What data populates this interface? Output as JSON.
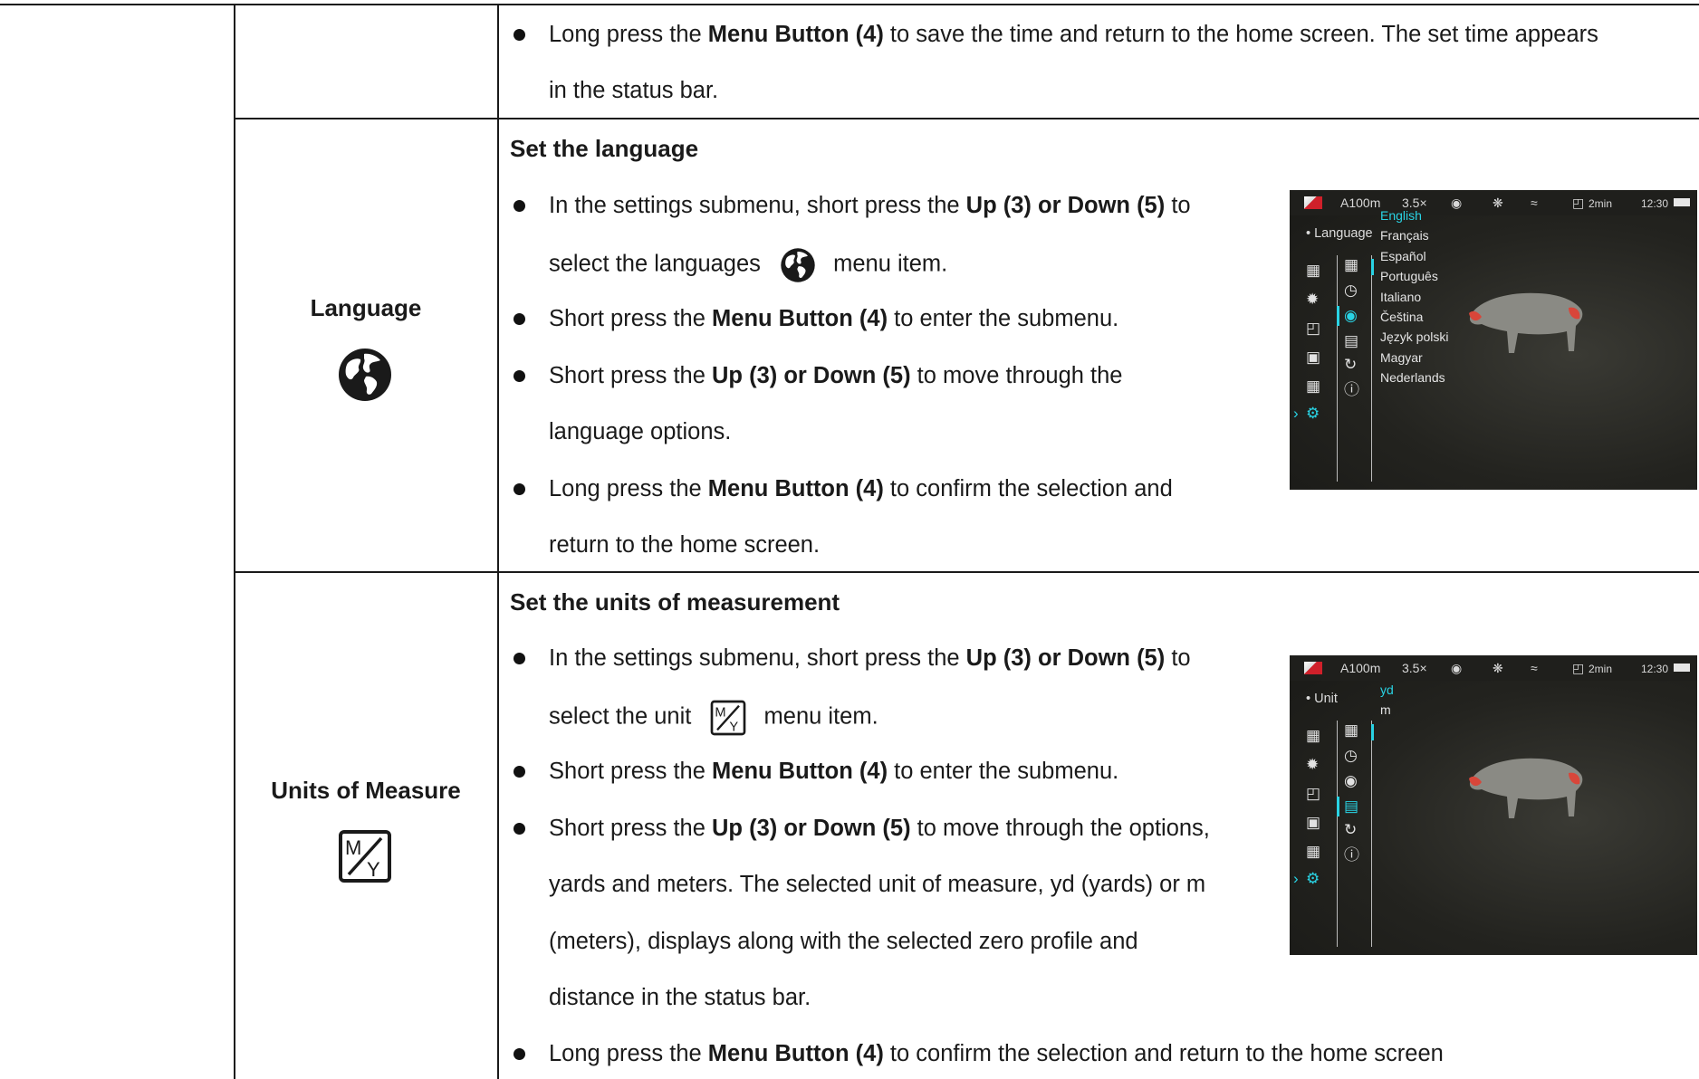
{
  "time_row": {
    "bullet1": {
      "pre": "Long press the ",
      "bold": "Menu Button (4)",
      "post": " to save the time and return to the home screen. The set time appears",
      "line2": "in the status bar."
    }
  },
  "language_row": {
    "label": "Language",
    "icon": "globe-icon",
    "heading": "Set the language",
    "b1": {
      "pre": "In the settings submenu, short press the ",
      "bold": "Up (3) or Down (5)",
      "post": " to",
      "line2_pre": "select the languages",
      "line2_post": "menu item."
    },
    "b2": {
      "pre": "Short press the ",
      "bold": "Menu Button (4)",
      "post": " to enter the submenu."
    },
    "b3": {
      "pre": "Short press the ",
      "bold": "Up (3) or Down (5)",
      "post": " to move through the",
      "line2": "language options."
    },
    "b4": {
      "pre": "Long press the ",
      "bold": "Menu Button (4)",
      "post": " to confirm the selection and",
      "line2": "return to the home screen."
    },
    "screenshot": {
      "status": {
        "range": "A100m",
        "zoom": "3.5×",
        "timer": "2min",
        "clock": "12:30"
      },
      "crumb": "• Language",
      "options": [
        "English",
        "Français",
        "Español",
        "Português",
        "Italiano",
        "Čeština",
        "Język polski",
        "Magyar",
        "Nederlands"
      ],
      "selected": "English"
    }
  },
  "units_row": {
    "label": "Units of Measure",
    "icon": "units-icon",
    "icon_m": "M",
    "icon_y": "Y",
    "heading": "Set the units of measurement",
    "b1": {
      "pre": "In the settings submenu, short press the ",
      "bold": "Up (3) or Down (5)",
      "post": " to",
      "line2_pre": "select the unit",
      "line2_post": "menu item."
    },
    "b2": {
      "pre": "Short press the ",
      "bold": "Menu Button (4)",
      "post": " to enter the submenu."
    },
    "b3": {
      "pre": "Short press the ",
      "bold": "Up (3) or Down (5)",
      "post": " to move through the options,",
      "line2": "yards and meters. The selected unit of measure, yd (yards) or m",
      "line3": "(meters), displays along with the selected zero profile and",
      "line4": "distance in the status bar."
    },
    "b4": {
      "pre": "Long press the ",
      "bold": "Menu Button (4)",
      "post": " to confirm the selection and return to the home screen"
    },
    "screenshot": {
      "status": {
        "range": "A100m",
        "zoom": "3.5×",
        "timer": "2min",
        "clock": "12:30"
      },
      "crumb": "• Unit",
      "options": [
        "yd",
        "m"
      ],
      "selected": "yd"
    }
  },
  "colors": {
    "accent": "#29d3e4",
    "rule": "#1a1a1a",
    "text": "#1a1a1a"
  }
}
